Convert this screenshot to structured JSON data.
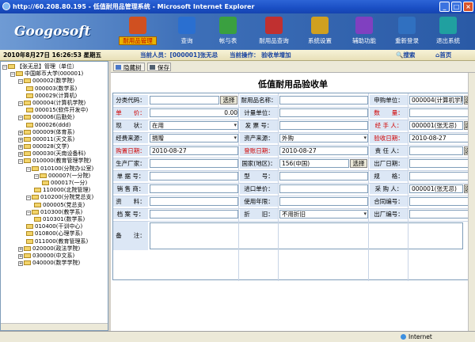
{
  "window": {
    "title": "http://60.208.80.195 - 低值耐用品管理系统 - Microsoft Internet Explorer"
  },
  "banner": {
    "logo": "Googosoft",
    "nav": [
      {
        "label": "耐用品管理",
        "icon": "durables-icon",
        "color": "#d05020",
        "active": true
      },
      {
        "label": "查询",
        "icon": "query-icon",
        "color": "#2a6fd0",
        "active": false
      },
      {
        "label": "帐与表",
        "icon": "ledger-icon",
        "color": "#3aa040",
        "active": false
      },
      {
        "label": "耐用品查询",
        "icon": "chart-icon",
        "color": "#c03030",
        "active": false
      },
      {
        "label": "系统设置",
        "icon": "settings-icon",
        "color": "#d0a020",
        "active": false
      },
      {
        "label": "辅助功能",
        "icon": "tools-icon",
        "color": "#8040c0",
        "active": false
      },
      {
        "label": "重新登录",
        "icon": "relogin-icon",
        "color": "#3070c0",
        "active": false
      },
      {
        "label": "退出系统",
        "icon": "exit-icon",
        "color": "#20a0a0",
        "active": false
      }
    ]
  },
  "strip": {
    "date": "2010年8月27日  16:26:53  星期五",
    "current_user_label": "当前人员：[000001]张无忌",
    "operation_label": "当前操作：  验收单增加",
    "search": "搜索",
    "home": "首页"
  },
  "tree": [
    {
      "d": 0,
      "pm": "-",
      "t": "【张无忌】管理（单位）"
    },
    {
      "d": 1,
      "pm": "-",
      "t": "中国邮币大学(000001)"
    },
    {
      "d": 2,
      "pm": "-",
      "t": "000002(数学院)"
    },
    {
      "d": 3,
      "pm": "",
      "t": "000003(数学系)"
    },
    {
      "d": 3,
      "pm": "",
      "t": "000029(计算机)"
    },
    {
      "d": 2,
      "pm": "-",
      "t": "000004(计算机学院)"
    },
    {
      "d": 3,
      "pm": "",
      "t": "000015(软件开发中)"
    },
    {
      "d": 2,
      "pm": "-",
      "t": "000006(后勤处)"
    },
    {
      "d": 3,
      "pm": "",
      "t": "000026(ddd)"
    },
    {
      "d": 2,
      "pm": "+",
      "t": "000009(体育系)"
    },
    {
      "d": 2,
      "pm": "+",
      "t": "000011(天文系)"
    },
    {
      "d": 2,
      "pm": "+",
      "t": "000028(文学)"
    },
    {
      "d": 2,
      "pm": "+",
      "t": "000030(天南设备科)"
    },
    {
      "d": 2,
      "pm": "-",
      "t": "010000(教育管理学院)"
    },
    {
      "d": 3,
      "pm": "-",
      "t": "010100(分院办公室)"
    },
    {
      "d": 4,
      "pm": "-",
      "t": "000007(一分院)"
    },
    {
      "d": 5,
      "pm": "",
      "t": "000017(一分)"
    },
    {
      "d": 4,
      "pm": "",
      "t": "110000(北院管理)"
    },
    {
      "d": 3,
      "pm": "-",
      "t": "010200(分院党总支)"
    },
    {
      "d": 4,
      "pm": "",
      "t": "000005(党总支)"
    },
    {
      "d": 3,
      "pm": "-",
      "t": "010300(教学系)"
    },
    {
      "d": 4,
      "pm": "",
      "t": "010301(数学系)"
    },
    {
      "d": 3,
      "pm": "",
      "t": "010400(干训中心)"
    },
    {
      "d": 3,
      "pm": "",
      "t": "010800(心理学系)"
    },
    {
      "d": 3,
      "pm": "",
      "t": "011000(教育管理系)"
    },
    {
      "d": 2,
      "pm": "+",
      "t": "020000(政法学院)"
    },
    {
      "d": 2,
      "pm": "+",
      "t": "030000(中文系)"
    },
    {
      "d": 2,
      "pm": "+",
      "t": "040000(数学学院)"
    }
  ],
  "toolbar": {
    "hide_tree": "隐藏树",
    "save": "保存"
  },
  "form": {
    "title": "低值耐用品验收单",
    "select_btn": "选择",
    "select_btn_short": "选",
    "fields": {
      "category_code": {
        "label": "分类代码："
      },
      "name": {
        "label": "耐用品名称："
      },
      "purchase_unit": {
        "label": "申购单位：",
        "value": "000004(计算机学院)"
      },
      "unit_price": {
        "label": "单　　价：",
        "value": "0.00"
      },
      "measure_unit": {
        "label": "计量单位："
      },
      "quantity": {
        "label": "数　　量："
      },
      "status": {
        "label": "现　　状：",
        "value": "在用"
      },
      "invoice_no": {
        "label": "发 票 号："
      },
      "handler": {
        "label": "经 手 人：",
        "value": "000001(张无忌)"
      },
      "funding": {
        "label": "经费来源：",
        "value": "捐赠"
      },
      "asset_source": {
        "label": "资产来源：",
        "value": "外购"
      },
      "accept_date": {
        "label": "验收日期：",
        "value": "2010-08-27"
      },
      "purchase_date": {
        "label": "购置日期：",
        "value": "2010-08-27"
      },
      "booking_date": {
        "label": "登账日期：",
        "value": "2010-08-27"
      },
      "responsible": {
        "label": "责 任 人："
      },
      "manufacturer": {
        "label": "生产厂家："
      },
      "country": {
        "label": "国家(地区)：",
        "value": "156(中国)"
      },
      "factory_date": {
        "label": "出厂日期："
      },
      "invoice_count": {
        "label": "单 据 号："
      },
      "model": {
        "label": "型　　号："
      },
      "spec": {
        "label": "规　　格："
      },
      "seller": {
        "label": "销 售 商："
      },
      "import_unit": {
        "label": "进口单价："
      },
      "buyer": {
        "label": "采 购 人：",
        "value": "000001(张无忌)"
      },
      "materials": {
        "label": "资　　料："
      },
      "use_years": {
        "label": "使用年限："
      },
      "contract_no": {
        "label": "合同编号："
      },
      "archive_no": {
        "label": "档 案 号："
      },
      "depreciation": {
        "label": "折　　旧：",
        "value": "不用折旧"
      },
      "factory_no": {
        "label": "出厂编号："
      },
      "remarks": {
        "label": "备　　注："
      }
    }
  },
  "status": {
    "zone": "Internet"
  }
}
